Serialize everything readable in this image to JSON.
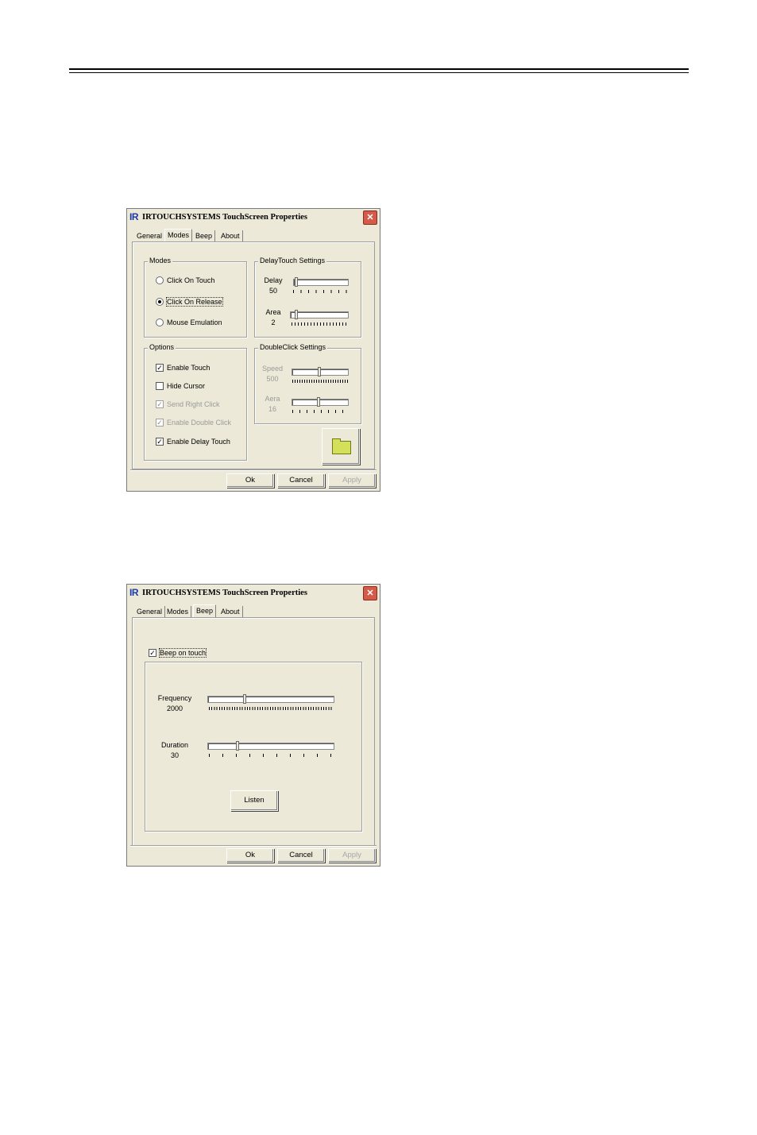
{
  "windows": [
    {
      "logo": "IR",
      "title": "IRTOUCHSYSTEMS TouchScreen Properties",
      "close": "✕",
      "tabs": [
        "General",
        "Modes",
        "Beep",
        "About"
      ],
      "active_tab": "Modes",
      "modes_group": {
        "title": "Modes",
        "options": [
          "Click On Touch",
          "Click On Release",
          "Mouse Emulation"
        ],
        "selected": "Click On Release"
      },
      "options_group": {
        "title": "Options",
        "items": [
          {
            "label": "Enable Touch",
            "checked": true,
            "enabled": true
          },
          {
            "label": "Hide Cursor",
            "checked": false,
            "enabled": true
          },
          {
            "label": "Send Right Click",
            "checked": true,
            "enabled": false
          },
          {
            "label": "Enable Double Click",
            "checked": true,
            "enabled": false
          },
          {
            "label": "Enable Delay Touch",
            "checked": true,
            "enabled": true
          }
        ]
      },
      "delaytouch_group": {
        "title": "DelayTouch Settings",
        "delay_label": "Delay",
        "delay_value": "50",
        "area_label": "Area",
        "area_value": "2"
      },
      "doubleclick_group": {
        "title": "DoubleClick Settings",
        "speed_label": "Speed",
        "speed_value": "500",
        "area_label": "Aera",
        "area_value": "16"
      },
      "buttons": {
        "ok": "Ok",
        "cancel": "Cancel",
        "apply": "Apply"
      }
    },
    {
      "logo": "IR",
      "title": "IRTOUCHSYSTEMS TouchScreen Properties",
      "close": "✕",
      "tabs": [
        "General",
        "Modes",
        "Beep",
        "About"
      ],
      "active_tab": "Beep",
      "beep_on_touch": {
        "label": "Beep on touch",
        "checked": true
      },
      "frequency": {
        "label": "Frequency",
        "value": "2000"
      },
      "duration": {
        "label": "Duration",
        "value": "30"
      },
      "listen_button": "Listen",
      "buttons": {
        "ok": "Ok",
        "cancel": "Cancel",
        "apply": "Apply"
      }
    }
  ],
  "colors": {
    "dialog_bg": "#ece9d8",
    "close_button": "#d45b4a",
    "logo": "#1c3aa8",
    "folder": "#d4e05a"
  },
  "icons": [
    "close-icon",
    "folder-icon"
  ]
}
